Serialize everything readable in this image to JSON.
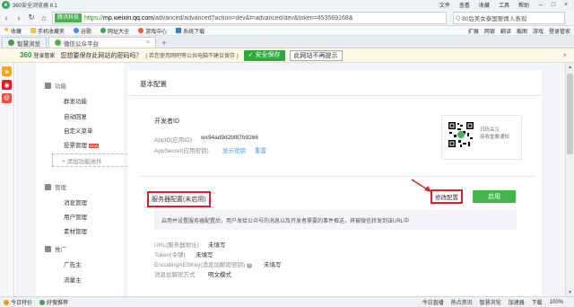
{
  "browser": {
    "app_title": "360安全浏览器 8.1",
    "title_menus": [
      "文件",
      "查看",
      "收藏",
      "工具",
      "帮助"
    ],
    "secure_tag": "腾讯科技",
    "url_https": "https://",
    "url_domain": "mp.weixin.qq.com",
    "url_rest": "/advanced/advanced?action=dev&t=advanced/dev&token=453569168&",
    "search_text": "80后美女泰国娶情人表现",
    "bookmarks": [
      "收藏",
      "手机收藏夹",
      "谷歌",
      "网址大全",
      "游戏中心",
      "系统下载"
    ],
    "bookmarks_right": [
      "扩展",
      "网银",
      "翻译",
      "截图",
      "游戏",
      "登录管家"
    ],
    "tabs": [
      {
        "label": "智慧浏览"
      },
      {
        "label": "微信公众平台",
        "close": "×"
      }
    ],
    "tab_new": "+"
  },
  "password_bar": {
    "logo": "360",
    "logo_sub": "登录管家",
    "question": "您想要保存此网站的密码吗？",
    "note": "( 若您使用网吧等公共电脑不建议保存 )",
    "save_label": "✓ 安全保存",
    "never_label": "此网站不再提示",
    "close": "×"
  },
  "sidebar": {
    "sections": [
      {
        "label": "功能",
        "items": [
          {
            "label": "群发功能"
          },
          {
            "label": "自动回复"
          },
          {
            "label": "自定义菜单"
          },
          {
            "label": "投票管理",
            "badge": "NEW"
          }
        ]
      },
      {
        "label": "管理",
        "items": [
          {
            "label": "消息管理"
          },
          {
            "label": "用户管理"
          },
          {
            "label": "素材管理"
          }
        ]
      },
      {
        "label": "推广",
        "items": [
          {
            "label": "广告主"
          },
          {
            "label": "流量主"
          }
        ]
      }
    ],
    "add_plugin": "+ 添加功能插件"
  },
  "main": {
    "title": "基本配置",
    "developer_id_title": "开发者ID",
    "appid_label": "AppID(应用ID)",
    "appid_value": "wx94ad9d2bf87b9266",
    "appsecret_label": "AppSecret(应用密钥)",
    "show_secret": "显示密钥",
    "reset": "重置",
    "qr_text_1": "扫码关注",
    "qr_text_2": "接收重要通知",
    "server_title": "服务器配置(未启用)",
    "modify_btn": "修改配置",
    "enable_btn": "启用",
    "info_text": "启用并设置服务器配置后，用户发给公众号的消息以及开发者需要的事件推送，将被微信转发到该URL中",
    "config": [
      {
        "label": "URL(服务器地址)",
        "value": "未填写"
      },
      {
        "label": "Token(令牌)",
        "value": "未填写"
      },
      {
        "label": "EncodingAESKey(消息加解密密钥)",
        "value": "未填写",
        "help": "?"
      },
      {
        "label": "消息加解密方式",
        "value": "明文模式"
      }
    ]
  },
  "statusbar": {
    "items": [
      "今日特价",
      "好搜推荐"
    ],
    "right": [
      "今日直播",
      "热点资讯",
      "智慧浏览",
      "加速器",
      "下载",
      "100%"
    ]
  },
  "colors": {
    "accent_green": "#44b549",
    "highlight_red": "#e31e24",
    "link_blue": "#459ae9"
  }
}
